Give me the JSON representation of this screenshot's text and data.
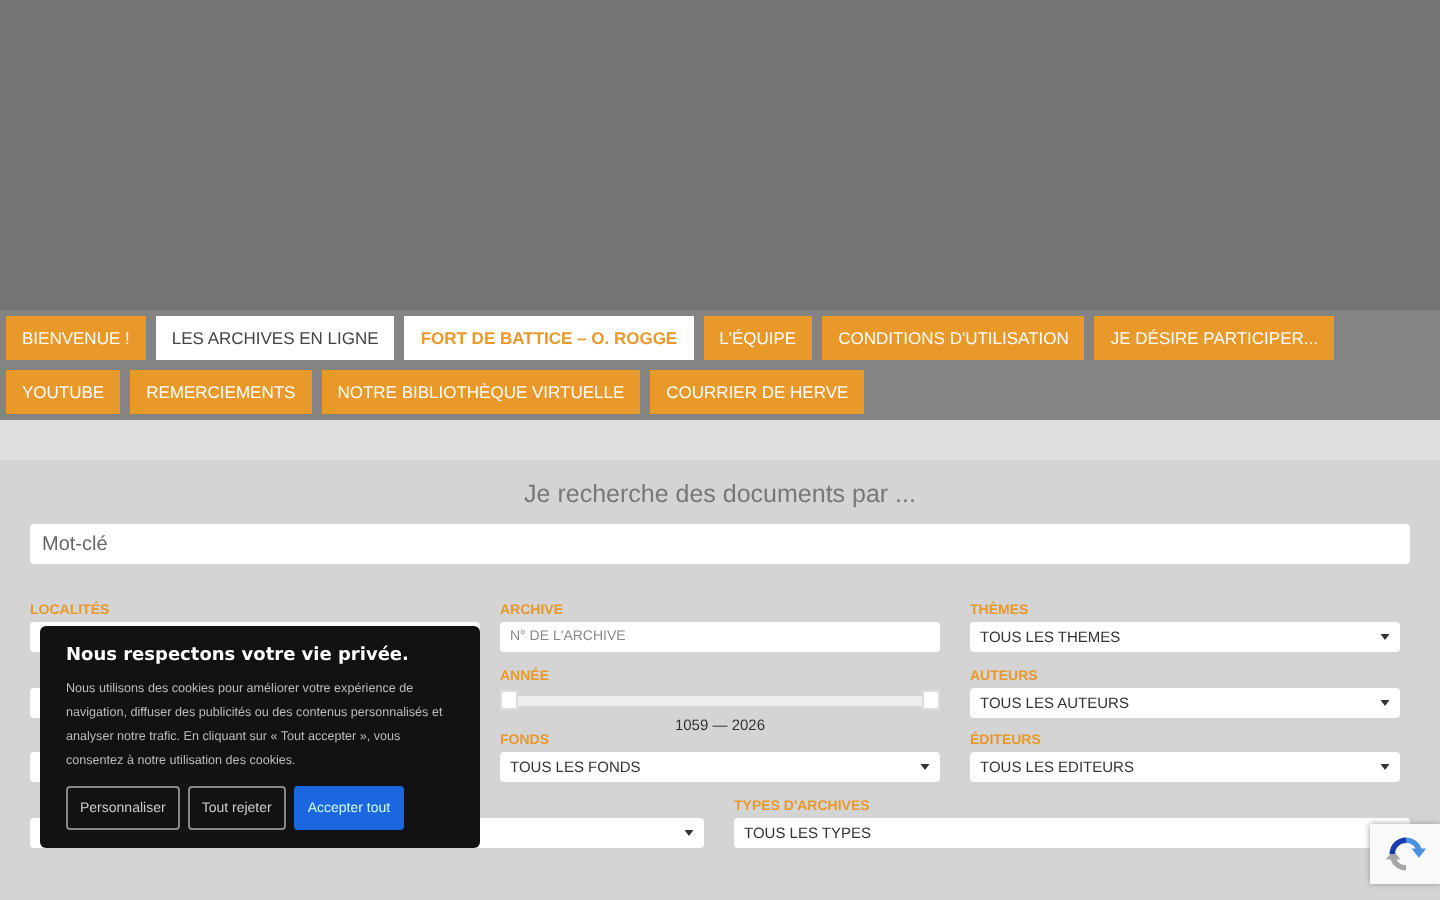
{
  "nav": [
    {
      "label": "BIENVENUE !",
      "kind": "link"
    },
    {
      "label": "LES ARCHIVES EN LIGNE",
      "kind": "open"
    },
    {
      "label": "FORT DE BATTICE – O. ROGGE",
      "kind": "current"
    },
    {
      "label": "L'ÉQUIPE",
      "kind": "link"
    },
    {
      "label": "CONDITIONS D'UTILISATION",
      "kind": "link"
    },
    {
      "label": "JE DÉSIRE PARTICIPER...",
      "kind": "link"
    },
    {
      "label": "YOUTUBE",
      "kind": "link"
    },
    {
      "label": "REMERCIEMENTS",
      "kind": "link"
    },
    {
      "label": "NOTRE BIBLIOTHÈQUE VIRTUELLE",
      "kind": "link"
    },
    {
      "label": "COURRIER DE HERVE",
      "kind": "link"
    }
  ],
  "search": {
    "heading": "Je recherche des documents par ...",
    "keyword": {
      "placeholder": "Mot-clé"
    }
  },
  "filter_columns": [
    [
      {
        "kind": "select",
        "label": "LOCALITÉS"
      },
      {
        "kind": "select"
      },
      {
        "kind": "select"
      }
    ],
    [
      {
        "kind": "text",
        "label": "ARCHIVE",
        "placeholder": "N° DE L'ARCHIVE"
      },
      {
        "kind": "range",
        "label": "ANNÉE",
        "reading": "1059 — 2026",
        "thumbs": [
          {
            "level": 0
          },
          {
            "level": 1
          }
        ]
      },
      {
        "kind": "select",
        "label": "FONDS",
        "value": "TOUS LES FONDS"
      }
    ],
    [
      {
        "kind": "select",
        "label": "THÈMES",
        "value": "TOUS LES THEMES"
      },
      {
        "kind": "select",
        "label": "AUTEURS",
        "value": "TOUS LES AUTEURS"
      },
      {
        "kind": "select",
        "label": "ÉDITEURS",
        "value": "TOUS LES EDITEURS"
      }
    ]
  ],
  "filter_row": [
    {
      "kind": "select"
    },
    {
      "kind": "select",
      "label": "TYPES D'ARCHIVES",
      "value": "TOUS LES TYPES"
    }
  ],
  "cookie_notice": {
    "title": "Nous respectons votre vie privée.",
    "text": "Nous utilisons des cookies pour améliorer votre expérience de navigation, diffuser des publicités ou des contenus personnalisés et analyser notre trafic. En cliquant sur « Tout accepter », vous consentez à notre utilisation des cookies.",
    "buttons": [
      {
        "label": "Personnaliser",
        "kind": "outline"
      },
      {
        "label": "Tout rejeter",
        "kind": "outline"
      },
      {
        "label": "Accepter tout",
        "kind": "primary"
      }
    ]
  }
}
